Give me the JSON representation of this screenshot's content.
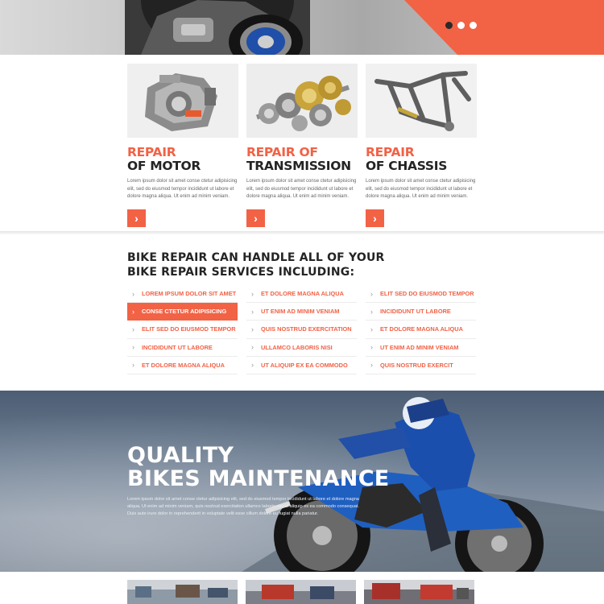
{
  "hero": {
    "slider_dots": [
      {
        "label": "slide-1",
        "active": true
      },
      {
        "label": "slide-2",
        "active": false
      },
      {
        "label": "slide-3",
        "active": false
      }
    ],
    "accent_color": "#f26245"
  },
  "services": [
    {
      "title_highlight": "REPAIR",
      "title_rest": "OF MOTOR",
      "text": "Lorem ipsum dolor sit amet conse ctetur adipisicing elit, sed do eiusmod tempor incididunt ut labore et dolore magna aliqua. Ut enim ad minim veniam.",
      "button_icon": "chevron-right-icon",
      "image": "motor-engine"
    },
    {
      "title_highlight": "REPAIR OF",
      "title_rest": "TRANSMISSION",
      "text": "Lorem ipsum dolor sit amet conse ctetur adipisicing elit, sed do eiusmod tempor incididunt ut labore et dolore magna aliqua. Ut enim ad minim veniam.",
      "button_icon": "chevron-right-icon",
      "image": "gears"
    },
    {
      "title_highlight": "REPAIR",
      "title_rest": "OF CHASSIS",
      "text": "Lorem ipsum dolor sit amet conse ctetur adipisicing elit, sed do eiusmod tempor incididunt ut labore et dolore magna aliqua. Ut enim ad minim veniam.",
      "button_icon": "chevron-right-icon",
      "image": "chassis-frame"
    }
  ],
  "list_section": {
    "title": "BIKE REPAIR CAN HANDLE ALL OF YOUR BIKE REPAIR SERVICES INCLUDING:",
    "columns": [
      [
        "LOREM IPSUM DOLOR SIT AMET",
        "CONSE CTETUR ADIPISICING",
        "ELIT SED DO EIUSMOD TEMPOR",
        "INCIDIDUNT UT LABORE",
        "ET DOLORE MAGNA ALIQUA"
      ],
      [
        "ET DOLORE MAGNA ALIQUA",
        "UT ENIM AD MINIM VENIAM",
        "QUIS NOSTRUD EXERCITATION",
        "ULLAMCO LABORIS NISI",
        "UT ALIQUIP EX EA COMMODO"
      ],
      [
        "ELIT SED DO EIUSMOD TEMPOR",
        "INCIDIDUNT UT LABORE",
        "ET DOLORE MAGNA ALIQUA",
        "UT ENIM AD MINIM VENIAM",
        "QUIS NOSTRUD EXERCIT"
      ]
    ],
    "active_item": "CONSE CTETUR ADIPISICING"
  },
  "banner": {
    "title_line1": "QUALITY",
    "title_line2": "BIKES MAINTENANCE",
    "text": "Lorem ipsum dolor sit amet conse ctetur adipisicing elit, sed do eiusmod tempor incididunt ut labore et dolore magna aliqua. Ut enim ad minim veniam, quis nostrud exercitation ullamco laboris nisi ut aliquip ex ea commodo consequat. Duis aute irure dolor in reprehenderit in voluptate velit esse cillum dolore eu fugiat nulla pariatur."
  }
}
